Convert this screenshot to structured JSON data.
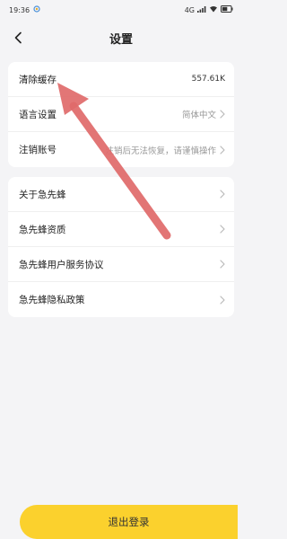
{
  "status_bar": {
    "time": "19:36",
    "network": "4G",
    "battery": "45"
  },
  "nav": {
    "title": "设置",
    "back_icon": "chevron-left-icon"
  },
  "settings_group_1": [
    {
      "label": "清除缓存",
      "value": "557.61K"
    },
    {
      "label": "语言设置",
      "value": "简体中文"
    },
    {
      "label": "注销账号",
      "value": "注销后无法恢复，请谨慎操作"
    }
  ],
  "settings_group_2": [
    {
      "label": "关于急先蜂"
    },
    {
      "label": "急先蜂资质"
    },
    {
      "label": "急先蜂用户服务协议"
    },
    {
      "label": "急先蜂隐私政策"
    }
  ],
  "logout": {
    "label": "退出登录"
  },
  "colors": {
    "accent": "#fbd12d",
    "annotation_arrow": "#e06a6a",
    "background": "#f4f4f6"
  }
}
